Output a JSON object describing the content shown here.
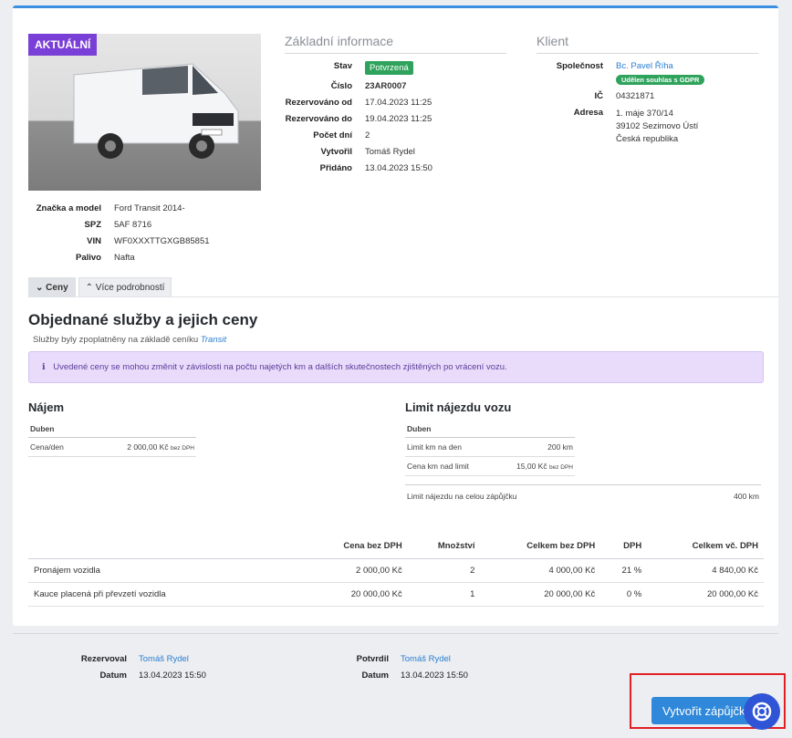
{
  "vehicle": {
    "badge": "AKTUÁLNÍ",
    "fields": [
      {
        "label": "Značka a model",
        "value": "Ford Transit 2014-"
      },
      {
        "label": "SPZ",
        "value": "5AF 8716"
      },
      {
        "label": "VIN",
        "value": "WF0XXXTTGXGB85851"
      },
      {
        "label": "Palivo",
        "value": "Nafta"
      }
    ]
  },
  "basic": {
    "title": "Základní informace",
    "status_label": "Stav",
    "status_value": "Potvrzená",
    "number_label": "Číslo",
    "number_value": "23AR0007",
    "from_label": "Rezervováno od",
    "from_value": "17.04.2023 11:25",
    "to_label": "Rezervováno do",
    "to_value": "19.04.2023 11:25",
    "days_label": "Počet dní",
    "days_value": "2",
    "created_by_label": "Vytvořil",
    "created_by_value": "Tomáš Rydel",
    "added_label": "Přidáno",
    "added_value": "13.04.2023 15:50"
  },
  "client": {
    "title": "Klient",
    "company_label": "Společnost",
    "company_value": "Bc. Pavel Říha",
    "gdpr_badge": "Udělen souhlas s GDPR",
    "ic_label": "IČ",
    "ic_value": "04321871",
    "address_label": "Adresa",
    "address_line1": "1. máje 370/14",
    "address_line2": "39102 Sezimovo Ústí",
    "address_line3": "Česká republika"
  },
  "tabs": [
    {
      "label": "Ceny",
      "icon": "chevron-down-icon"
    },
    {
      "label": "Více podrobností",
      "icon": "chevron-up-icon"
    }
  ],
  "services": {
    "title": "Objednané služby a jejich ceny",
    "subtitle_prefix": "Služby byly zpoplatněny na základě ceníku",
    "pricelist": "Transit",
    "notice": "Uvedené ceny se mohou změnit v závislosti na počtu najetých km a dalších skutečnostech zjištěných po vrácení vozu."
  },
  "rent": {
    "title": "Nájem",
    "month": "Duben",
    "row_label": "Cena/den",
    "row_value": "2 000,00 Kč",
    "row_suffix": "bez DPH"
  },
  "limit": {
    "title": "Limit nájezdu vozu",
    "month": "Duben",
    "km_label": "Limit km na den",
    "km_value": "200 km",
    "over_label": "Cena km nad limit",
    "over_value": "15,00 Kč",
    "over_suffix": "bez DPH",
    "total_label": "Limit nájezdu na celou zápůjčku",
    "total_value": "400 km"
  },
  "items": {
    "headers": [
      "",
      "Cena bez DPH",
      "Množství",
      "Celkem bez DPH",
      "DPH",
      "Celkem vč. DPH"
    ],
    "rows": [
      [
        "Pronájem vozidla",
        "2 000,00 Kč",
        "2",
        "4 000,00 Kč",
        "21 %",
        "4 840,00 Kč"
      ],
      [
        "Kauce placená při převzetí vozidla",
        "20 000,00 Kč",
        "1",
        "20 000,00 Kč",
        "0 %",
        "20 000,00 Kč"
      ]
    ]
  },
  "footer": {
    "reserved_label": "Rezervoval",
    "reserved_value": "Tomáš Rydel",
    "reserved_date_label": "Datum",
    "reserved_date_value": "13.04.2023 15:50",
    "confirmed_label": "Potvrdil",
    "confirmed_value": "Tomáš Rydel",
    "confirmed_date_label": "Datum",
    "confirmed_date_value": "13.04.2023 15:50"
  },
  "actions": {
    "create_label": "Vytvořit zápůjčku"
  },
  "colors": {
    "accent": "#2f88d9",
    "badge_purple": "#7a3fd6",
    "success": "#2fa35c",
    "highlight_red": "#e21f26"
  }
}
